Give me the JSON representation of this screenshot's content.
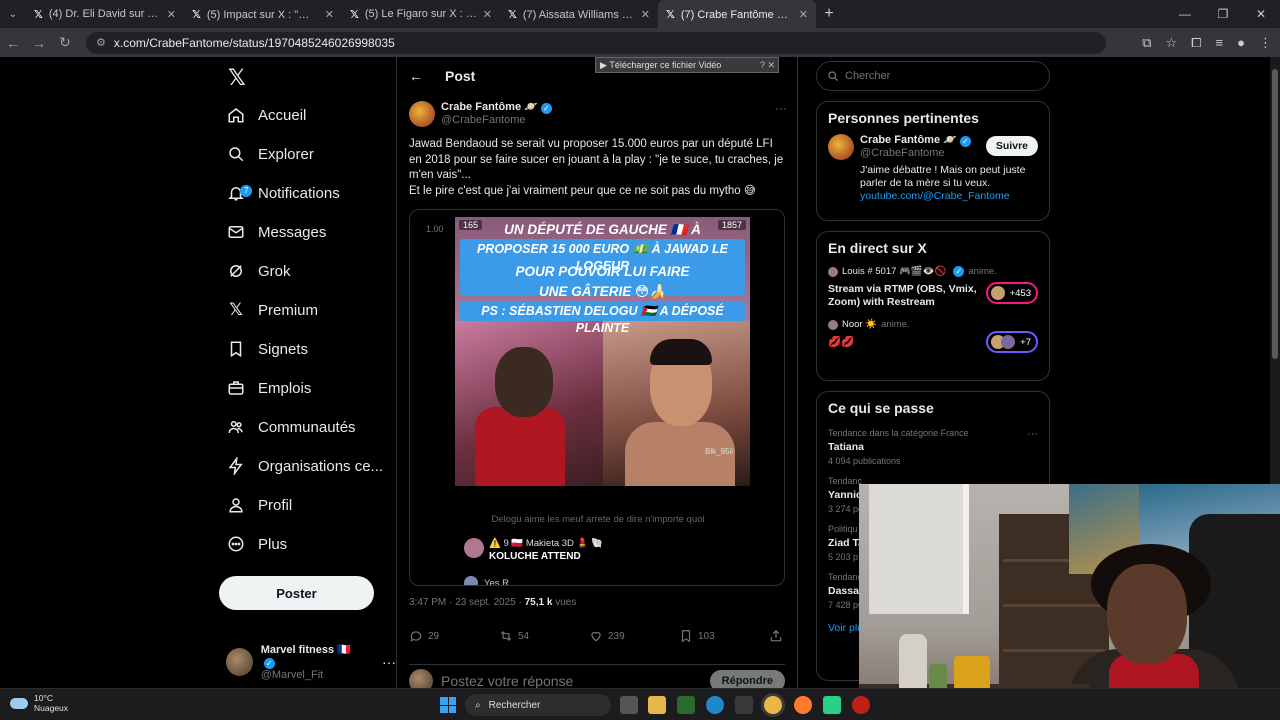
{
  "browser": {
    "tabs": [
      {
        "label": "(4) Dr. Eli David sur X : \"Trump's",
        "active": false
      },
      {
        "label": "(5) Impact sur X : \"🚨🇫🇷 FLASH",
        "active": false
      },
      {
        "label": "(5) Le Figaro sur X : \"«Rima Has",
        "active": false
      },
      {
        "label": "(7) Aissata Williams 🇸🇳 sur X : \"L",
        "active": false
      },
      {
        "label": "(7) Crabe Fantôme 🪐 sur X",
        "active": true
      }
    ],
    "url": "x.com/CrabeFantome/status/1970485246026998035"
  },
  "nav": {
    "items": [
      {
        "label": "Accueil",
        "icon": "home-icon"
      },
      {
        "label": "Explorer",
        "icon": "search-icon"
      },
      {
        "label": "Notifications",
        "icon": "bell-icon",
        "badge": "7"
      },
      {
        "label": "Messages",
        "icon": "mail-icon"
      },
      {
        "label": "Grok",
        "icon": "grok-icon"
      },
      {
        "label": "Premium",
        "icon": "x-icon"
      },
      {
        "label": "Signets",
        "icon": "bookmark-icon"
      },
      {
        "label": "Emplois",
        "icon": "briefcase-icon"
      },
      {
        "label": "Communautés",
        "icon": "people-icon"
      },
      {
        "label": "Organisations ce...",
        "icon": "bolt-icon"
      },
      {
        "label": "Profil",
        "icon": "user-icon"
      },
      {
        "label": "Plus",
        "icon": "more-circle-icon"
      }
    ],
    "post_button": "Poster",
    "account": {
      "name": "Marvel fitness 🇫🇷",
      "handle": "@Marvel_Fit"
    }
  },
  "post": {
    "header_title": "Post",
    "download_banner": "Télécharger ce fichier Vidéo",
    "author_name": "Crabe Fantôme 🪐",
    "author_handle": "@CrabeFantome",
    "text": "Jawad Bendaoud se serait vu proposer 15.000 euros par un député LFI en 2018 pour se faire sucer en jouant à la play : \"je te suce, tu craches, je m'en vais\"...\nEt le pire c'est que j'ai vraiment peur que ce ne soit pas du mytho 😅",
    "media": {
      "timestamp": "1.00",
      "counter_left": "165",
      "counter_right": "1857",
      "caption_lines": [
        "UN DÉPUTÉ DE GAUCHE 🇫🇷 À",
        "PROPOSER 15 000 EURO 💵 À JAWAD LE LOGEUR",
        "POUR POUVOIR LUI FAIRE",
        "UNE GÂTERIE 😳🍌",
        "PS : SÉBASTIEN DELOGU 🇵🇸 A DÉPOSÉ PLAINTE"
      ],
      "video_tag": "Blk_95ii",
      "comment_faint": "Delogu aime les meuf arrete de dire n'importe quoi",
      "comment_user": "⚠️ 9 🇵🇱 Makieta 3D 💄 🐚",
      "comment_text": "KOLUCHE ATTEND",
      "comment2": "Yes R"
    },
    "time": "3:47 PM · 23 sept. 2025 · ",
    "views_value": "75,1 k",
    "views_label": " vues",
    "actions": {
      "replies": "29",
      "reposts": "54",
      "likes": "239",
      "bookmarks": "103"
    },
    "reply_placeholder": "Postez votre réponse",
    "reply_button": "Répondre"
  },
  "right": {
    "search_placeholder": "Chercher",
    "relevant": {
      "title": "Personnes pertinentes",
      "name": "Crabe Fantôme 🪐",
      "handle": "@CrabeFantome",
      "follow": "Suivre",
      "bio": "J'aime débattre ! Mais on peut juste parler de ta mère si tu veux.",
      "link": "youtube.com/@Crabe_Fantome"
    },
    "live": {
      "title": "En direct sur X",
      "items": [
        {
          "user": "Louis # 5017 🎮🎬👁️🚫",
          "anim": "anime.",
          "text": "Stream via RTMP (OBS, Vmix, Zoom) with Restream",
          "count": "+453"
        },
        {
          "user": "Noor ☀️",
          "anim": "anime.",
          "text": "💋💋",
          "count": "+7"
        }
      ]
    },
    "trends": {
      "title": "Ce qui se passe",
      "items": [
        {
          "category": "Tendance dans la catégorie France",
          "name": "Tatiana",
          "count": "4 094 publications"
        },
        {
          "category": "Tendanc",
          "name": "Yannic",
          "count": "3 274 po"
        },
        {
          "category": "Politiqu",
          "name": "Ziad Ta",
          "count": "5 203 p"
        },
        {
          "category": "Tendanc",
          "name": "Dassa",
          "count": "7 428 pu"
        }
      ],
      "see_more": "Voir plu"
    }
  },
  "taskbar": {
    "temp": "10°C",
    "weather": "Nuageux",
    "search": "Rechercher"
  }
}
